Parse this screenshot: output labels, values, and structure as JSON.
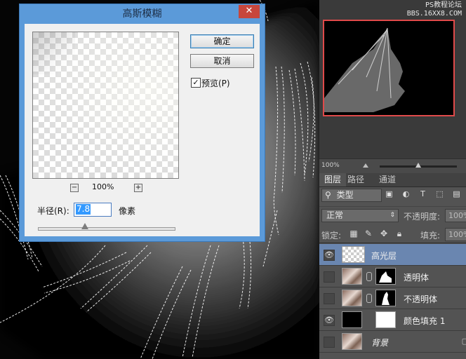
{
  "dialog": {
    "title": "高斯模糊",
    "close_label": "✕",
    "ok_label": "确定",
    "cancel_label": "取消",
    "preview_checked": true,
    "preview_label": "预览(P)",
    "zoom_out_label": "−",
    "zoom_in_label": "+",
    "zoom_value": "100%",
    "radius_label": "半径(R):",
    "radius_value": "7.8",
    "radius_unit": "像素"
  },
  "navigator": {
    "watermark_line1": "PS教程论坛",
    "watermark_line2": "BBS.16XX8.COM",
    "zoom_value": "100%",
    "frame_color": "#e04a4a"
  },
  "layers_panel": {
    "tabs": [
      "图层",
      "路径",
      "通道"
    ],
    "active_tab": "图层",
    "filter_kind": "类型",
    "blend_mode": "正常",
    "opacity_label": "不透明度:",
    "opacity_value": "100%",
    "lock_label": "锁定:",
    "fill_label": "填充:",
    "fill_value": "100%",
    "selection_color": "#6a86b0",
    "layers": [
      {
        "name": "高光层",
        "visible": true,
        "selected": true
      },
      {
        "name": "透明体",
        "visible": false,
        "selected": false
      },
      {
        "name": "不透明体",
        "visible": false,
        "selected": false
      },
      {
        "name": "颜色填充 1",
        "visible": true,
        "selected": false
      },
      {
        "name": "背景",
        "visible": false,
        "selected": false,
        "locked": true
      }
    ]
  }
}
